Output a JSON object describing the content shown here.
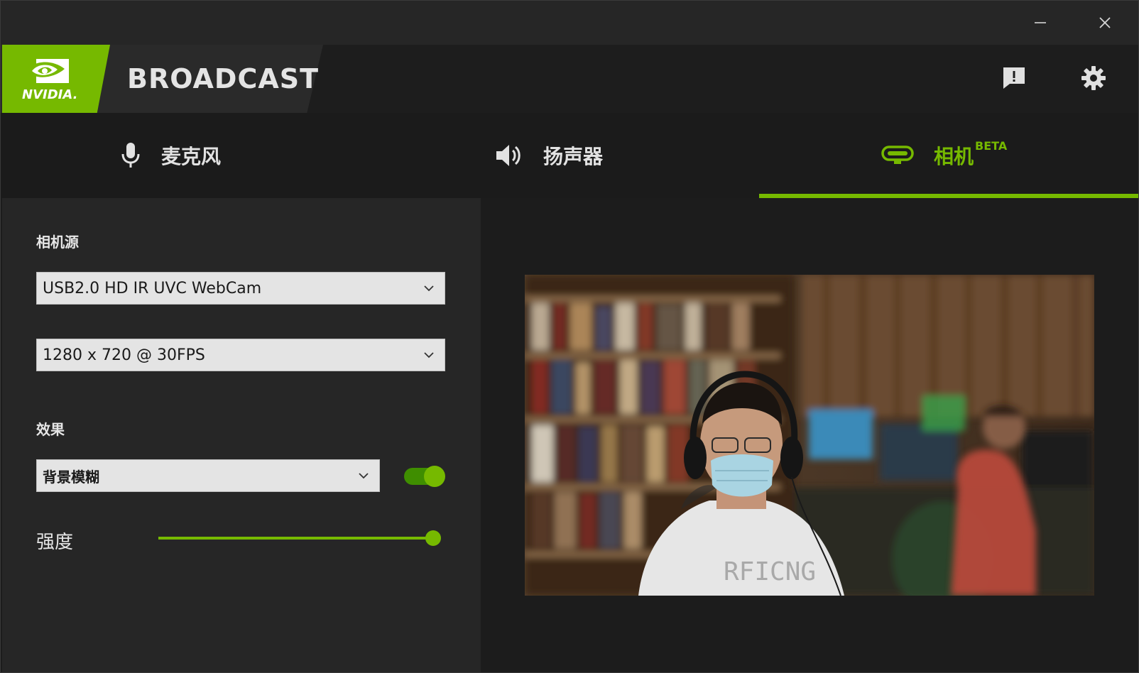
{
  "window": {
    "minimize_icon": "minimize-icon",
    "close_icon": "close-icon"
  },
  "header": {
    "logo_text": "NVIDIA.",
    "app_title": "BROADCAST",
    "feedback_icon": "feedback-icon",
    "settings_icon": "gear-icon"
  },
  "tabs": [
    {
      "label": "麦克风",
      "icon": "microphone-icon",
      "active": false
    },
    {
      "label": "扬声器",
      "icon": "speaker-icon",
      "active": false
    },
    {
      "label": "相机",
      "icon": "webcam-icon",
      "badge": "BETA",
      "active": true
    }
  ],
  "camera": {
    "source_label": "相机源",
    "source_value": "USB2.0 HD IR UVC WebCam",
    "resolution_value": "1280 x 720 @ 30FPS",
    "effects_label": "效果",
    "effect_value": "背景模糊",
    "effect_enabled": true,
    "strength_label": "强度",
    "strength_value": 1.0
  },
  "preview": {
    "shirt_text": "RFICNG"
  },
  "colors": {
    "accent": "#76b900",
    "toggle_track": "#3f8e00",
    "panel": "#262626",
    "background": "#1c1c1c",
    "select_bg": "#e4e4e4"
  }
}
